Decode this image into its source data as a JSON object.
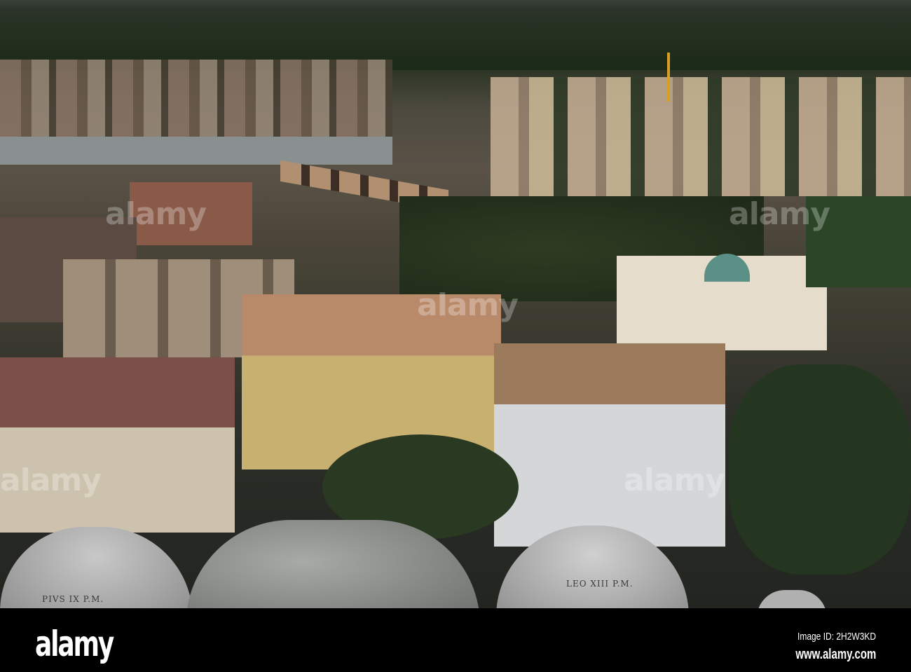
{
  "photo": {
    "subject": "Aerial view of Rome from dome",
    "inscriptions": [
      "PIVS IX P.M.",
      "LEO XIII P.M."
    ],
    "watermark": "alamy"
  },
  "footer": {
    "logo": "alamy",
    "image_id": "Image ID: 2H2W3KD",
    "website": "www.alamy.com"
  }
}
